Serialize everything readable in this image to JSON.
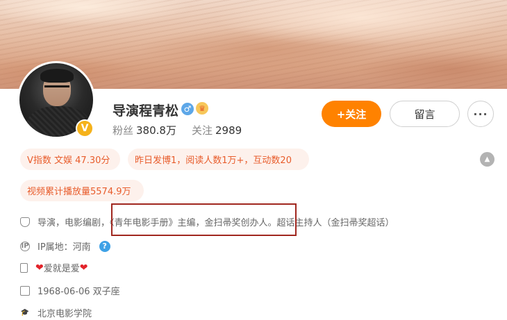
{
  "profile": {
    "name": "导演程青松",
    "verified_badge": "V",
    "gender_icon": "male-icon",
    "fans_label": "粉丝",
    "fans_count": "380.8万",
    "following_label": "关注",
    "following_count": "2989"
  },
  "actions": {
    "follow_label": "+关注",
    "message_label": "留言",
    "more_label": "···"
  },
  "tags": [
    "V指数 文娱 47.30分",
    "昨日发博1，阅读人数1万+，互动数20",
    "视频累计播放量5574.9万"
  ],
  "info": {
    "intro": "导演，电影编剧，《青年电影手册》主编，金扫帚奖创办人。超话主持人（金扫帚奖超话）",
    "ip": "IP属地：河南",
    "motto_text": "爱就是爱",
    "birthday": "1968-06-06 双子座",
    "school": "北京电影学院"
  },
  "colors": {
    "accent": "#ff8200",
    "tag_bg": "#fdf1ec",
    "tag_text": "#e85c2b",
    "highlight": "#a0271f"
  }
}
